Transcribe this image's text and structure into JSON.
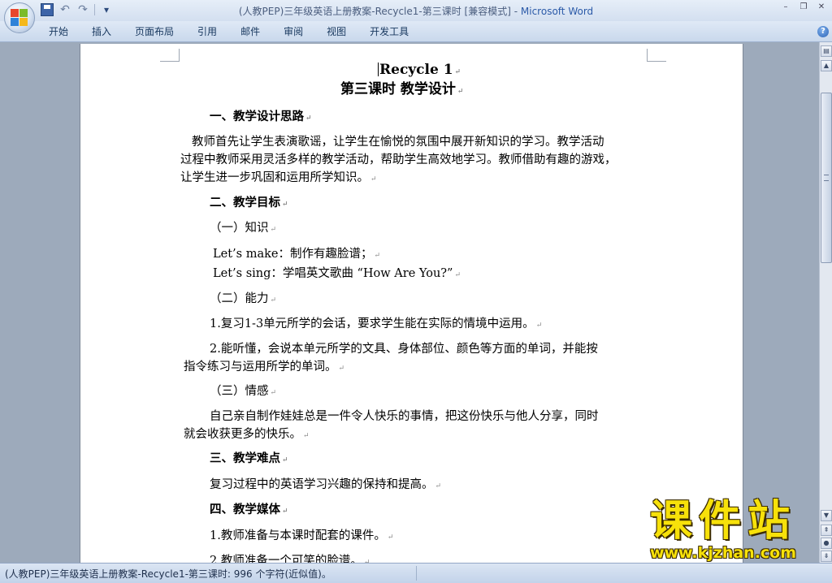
{
  "window": {
    "title_doc": "(人教PEP)三年级英语上册教案-Recycle1-第三课时 [兼容模式]",
    "title_sep": " - ",
    "title_app": "Microsoft Word"
  },
  "quick_access": {
    "icons": [
      "save-icon",
      "undo-icon",
      "redo-icon",
      "customize-icon"
    ],
    "undo_glyph": "↶",
    "redo_glyph": "↷",
    "customize_glyph": "▾"
  },
  "window_controls": {
    "minimize": "–",
    "restore": "❐",
    "close": "✕"
  },
  "ribbon": {
    "tabs": [
      "开始",
      "插入",
      "页面布局",
      "引用",
      "邮件",
      "审阅",
      "视图",
      "开发工具"
    ],
    "help_glyph": "?"
  },
  "document": {
    "para_mark": "↵",
    "title": "Recycle 1",
    "subtitle": "第三课时  教学设计",
    "s1_heading": "一、教学设计思路",
    "s1_p1": "教师首先让学生表演歌谣，让学生在愉悦的氛围中展开新知识的学习。教学活动",
    "s1_p2": "过程中教师采用灵活多样的教学活动，帮助学生高效地学习。教师借助有趣的游戏，",
    "s1_p3": "让学生进一步巩固和运用所学知识。",
    "s2_heading": "二、教学目标",
    "s2_sub1": "（一）知识",
    "s2_make": "Let’s make：制作有趣脸谱；",
    "s2_sing": "Let’s sing：学唱英文歌曲 “How Are You?”",
    "s2_sub2": "（二）能力",
    "s2_ab1": "1.复习1-3单元所学的会话，要求学生能在实际的情境中运用。",
    "s2_ab2a": "2.能听懂，会说本单元所学的文具、身体部位、颜色等方面的单词，并能按",
    "s2_ab2b": "指令练习与运用所学的单词。",
    "s2_sub3": "（三）情感",
    "s2_em_a": "自己亲自制作娃娃总是一件令人快乐的事情，把这份快乐与他人分享，同时",
    "s2_em_b": "就会收获更多的快乐。",
    "s3_heading": "三、教学难点",
    "s3_p": "复习过程中的英语学习兴趣的保持和提高。",
    "s4_heading": "四、教学媒体",
    "s4_p1": "1.教师准备与本课时配套的课件。",
    "s4_p2": "2.教师准备一个可笑的脸谱。"
  },
  "scrollbar": {
    "up": "▲",
    "down": "▼",
    "prev_page": "⇞",
    "next_page": "⇟",
    "browse": "●",
    "ruler": "▤"
  },
  "statusbar": {
    "text": "(人教PEP)三年级英语上册教案-Recycle1-第三课时: 996 个字符(近似值)。"
  },
  "watermark": {
    "main": "课件站",
    "url": "www.kjzhan.com"
  }
}
